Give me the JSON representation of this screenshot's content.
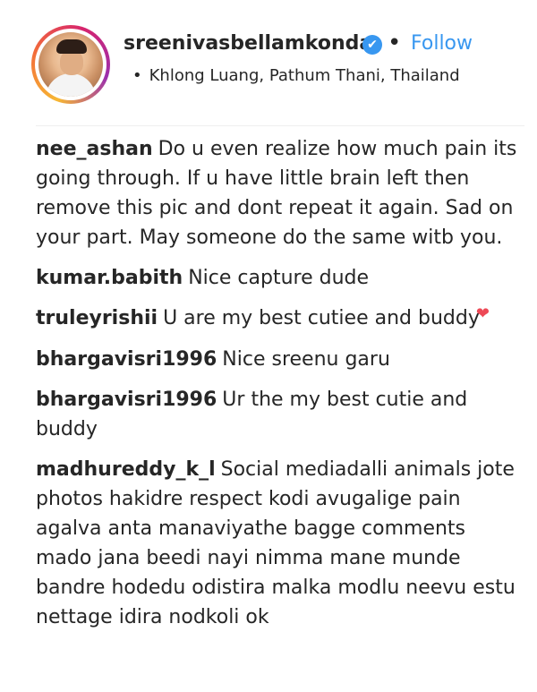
{
  "post_header": {
    "username": "sreenivasbellamkonda",
    "verified_symbol": "✔",
    "separator": "•",
    "follow_label": "Follow",
    "location_bullet": "•",
    "location": "Khlong Luang, Pathum Thani, Thailand"
  },
  "comments": [
    {
      "user": "nee_ashan",
      "text": "Do u even realize how much pain its going through. If u have little brain left then remove this pic and dont repeat it again. Sad on your part. May someone do the same witb you."
    },
    {
      "user": "kumar.babith",
      "text": "Nice capture dude"
    },
    {
      "user": "truleyrishii",
      "text": "U are my best cutiee and buddy",
      "emoji": "❤"
    },
    {
      "user": "bhargavisri1996",
      "text": "Nice sreenu garu"
    },
    {
      "user": "bhargavisri1996",
      "text": "Ur the my best cutie and buddy"
    },
    {
      "user": "madhureddy_k_l",
      "text": "Social mediadalli animals jote photos hakidre respect kodi avugalige pain agalva anta manaviyathe bagge comments mado jana beedi nayi nimma mane munde bandre hodedu odistira malka modlu neevu estu nettage idira nodkoli ok"
    }
  ],
  "colors": {
    "link_blue": "#3897f0",
    "text": "#262626",
    "heart_red": "#ed4956"
  }
}
